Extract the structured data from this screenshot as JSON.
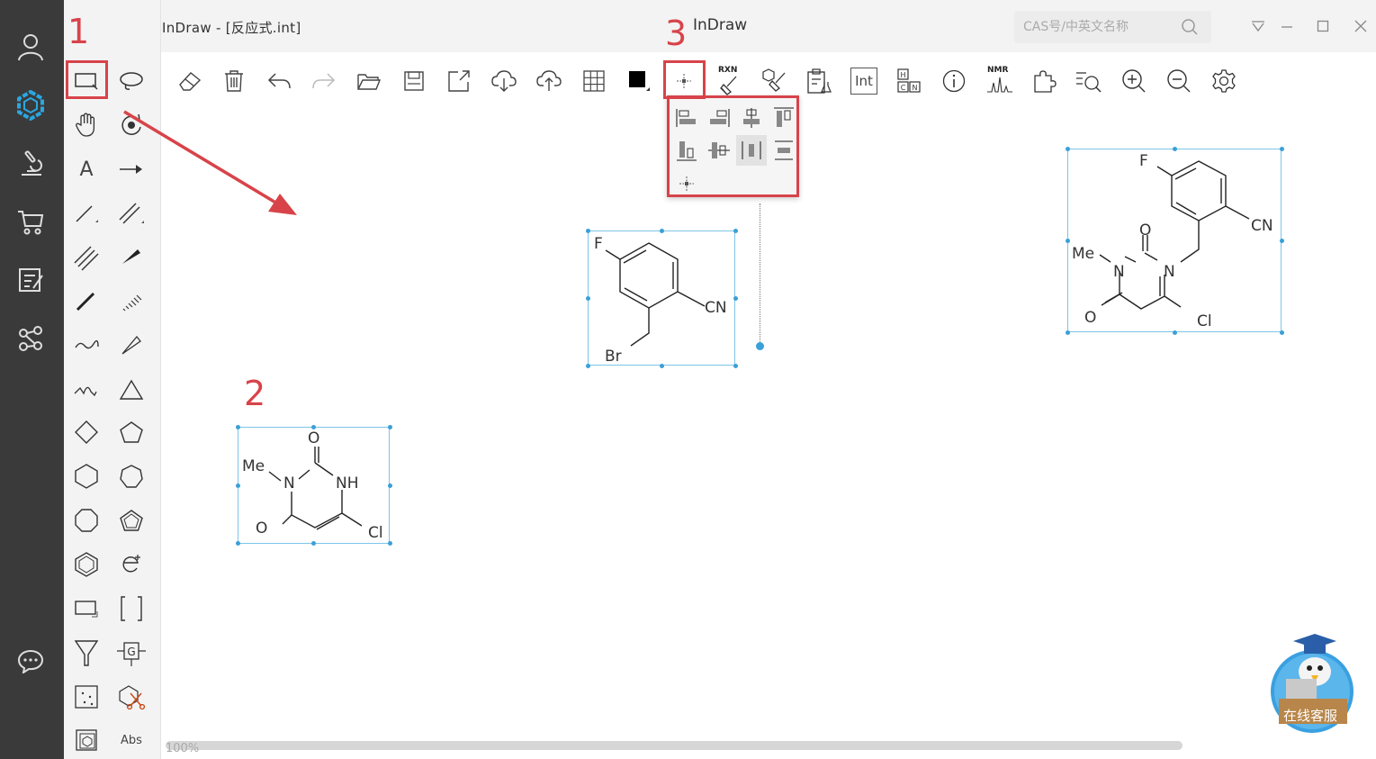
{
  "window": {
    "doc_title": "InDraw - [反应式.int]",
    "app_title": "InDraw",
    "search_placeholder": "CAS号/中英文名称"
  },
  "annotations": {
    "step1": "1",
    "step2": "2",
    "step3": "3",
    "accent_color": "#d8434a"
  },
  "palette": {
    "text_tool": "A",
    "abs_tool": "Abs",
    "int_button": "Int",
    "rxn_label": "RXN",
    "nmr_label": "NMR"
  },
  "molecules": {
    "mol1": {
      "F": "F",
      "CN": "CN",
      "Br": "Br"
    },
    "mol2": {
      "Me": "Me",
      "N1": "N",
      "NH": "NH",
      "O_top": "O",
      "O_bottom": "O",
      "Cl": "Cl"
    },
    "mol3": {
      "F": "F",
      "CN": "CN",
      "Me": "Me",
      "N1": "N",
      "N2": "N",
      "O_top": "O",
      "O_bottom": "O",
      "Cl": "Cl"
    }
  },
  "status": {
    "zoom": "100%"
  },
  "support": {
    "label": "在线客服"
  },
  "colors": {
    "sidebar_bg": "#3a3a3a",
    "selection": "#7ec4e8",
    "handle": "#3aa0d8",
    "logo": "#2aa7e0"
  }
}
